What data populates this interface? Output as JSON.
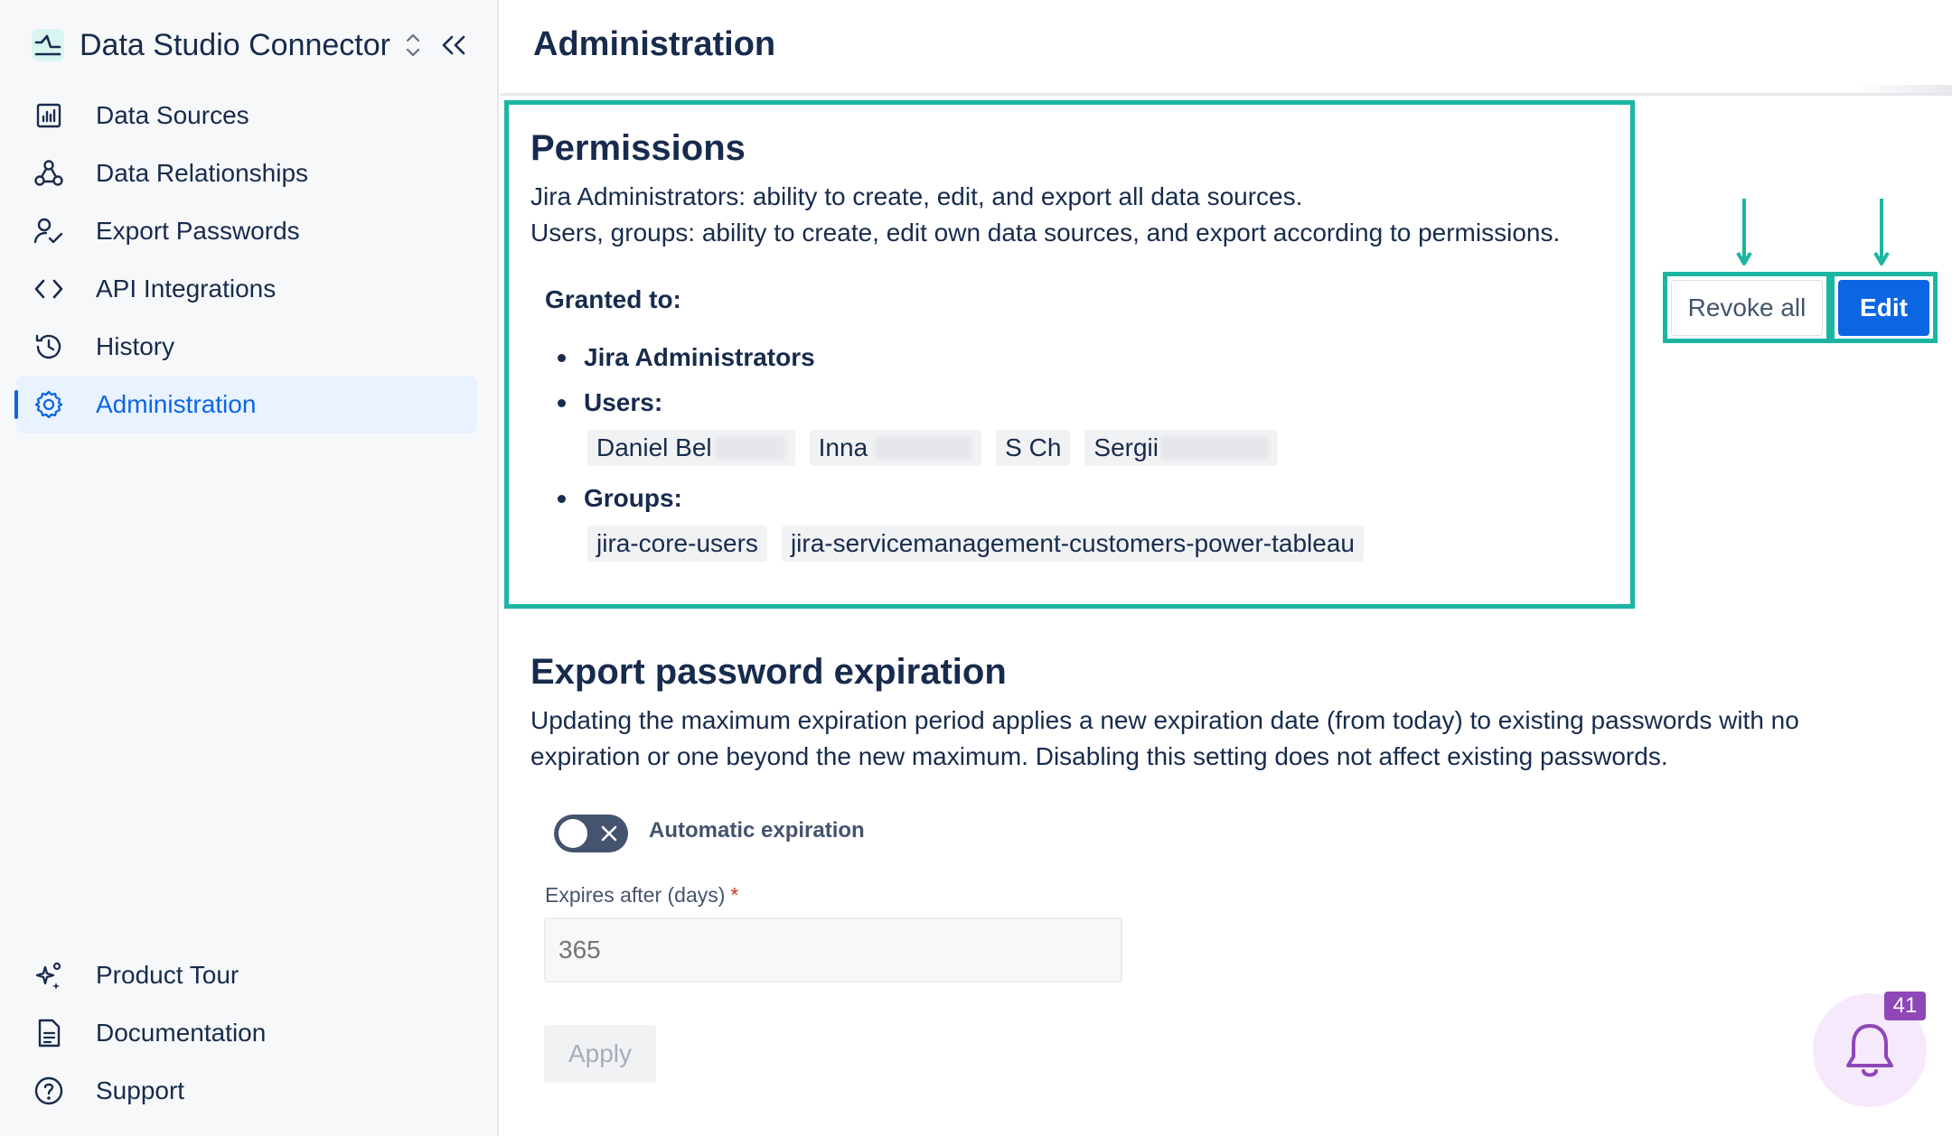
{
  "sidebar": {
    "app_title": "Data Studio Connector",
    "items": [
      {
        "label": "Data Sources",
        "icon": "bar-chart-icon"
      },
      {
        "label": "Data Relationships",
        "icon": "webhook-icon"
      },
      {
        "label": "Export Passwords",
        "icon": "user-check-icon"
      },
      {
        "label": "API Integrations",
        "icon": "code-icon"
      },
      {
        "label": "History",
        "icon": "history-icon"
      },
      {
        "label": "Administration",
        "icon": "gear-icon",
        "active": true
      }
    ],
    "bottom_items": [
      {
        "label": "Product Tour",
        "icon": "sparkle-icon"
      },
      {
        "label": "Documentation",
        "icon": "document-icon"
      },
      {
        "label": "Support",
        "icon": "help-icon"
      }
    ]
  },
  "header": {
    "title": "Administration"
  },
  "permissions": {
    "title": "Permissions",
    "description_line1": "Jira Administrators: ability to create, edit, and export all data sources.",
    "description_line2": "Users, groups: ability to create, edit own data sources, and export according to permissions.",
    "granted_label": "Granted to:",
    "admins_label": "Jira Administrators",
    "users_label": "Users:",
    "users": [
      "Daniel Bel",
      "Inna",
      "S Ch",
      "Sergii"
    ],
    "groups_label": "Groups:",
    "groups": [
      "jira-core-users",
      "jira-servicemanagement-customers-power-tableau"
    ],
    "revoke_label": "Revoke all",
    "edit_label": "Edit"
  },
  "expiration": {
    "title": "Export password expiration",
    "description_line1": "Updating the maximum expiration period applies a new expiration date (from today) to existing passwords with no",
    "description_line2": "expiration or one beyond the new maximum. Disabling this setting does not affect existing passwords.",
    "toggle_label": "Automatic expiration",
    "toggle_on": false,
    "field_label": "Expires after (days)",
    "required_mark": "*",
    "field_placeholder": "365",
    "apply_label": "Apply"
  },
  "notifications": {
    "count": "41",
    "icon": "bell-icon"
  },
  "colors": {
    "accent": "#0c66e4",
    "highlight": "#1bb6a2",
    "badge": "#8f46b8"
  }
}
